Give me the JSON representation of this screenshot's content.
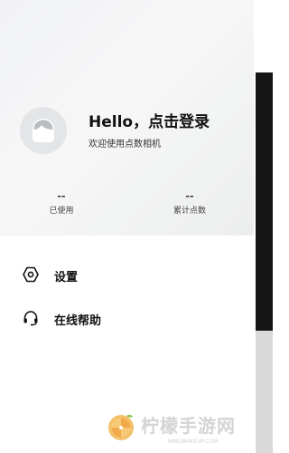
{
  "user": {
    "greeting": "Hello，点击登录",
    "subtitle": "欢迎使用点数相机",
    "avatar_icon": "default-user-avatar-icon"
  },
  "stats": [
    {
      "value": "--",
      "label": "已使用"
    },
    {
      "value": "--",
      "label": "累计点数"
    }
  ],
  "menu": {
    "items": [
      {
        "label": "设置",
        "icon": "gear-icon"
      },
      {
        "label": "在线帮助",
        "icon": "headset-icon"
      }
    ]
  },
  "watermark": {
    "brand": "柠檬手游网",
    "url": "NINGMAKEUP.COM"
  },
  "colors": {
    "header_bg": "#f2f3f5",
    "text_primary": "#111111",
    "text_secondary": "#444444",
    "overlay_dark": "#151515"
  }
}
